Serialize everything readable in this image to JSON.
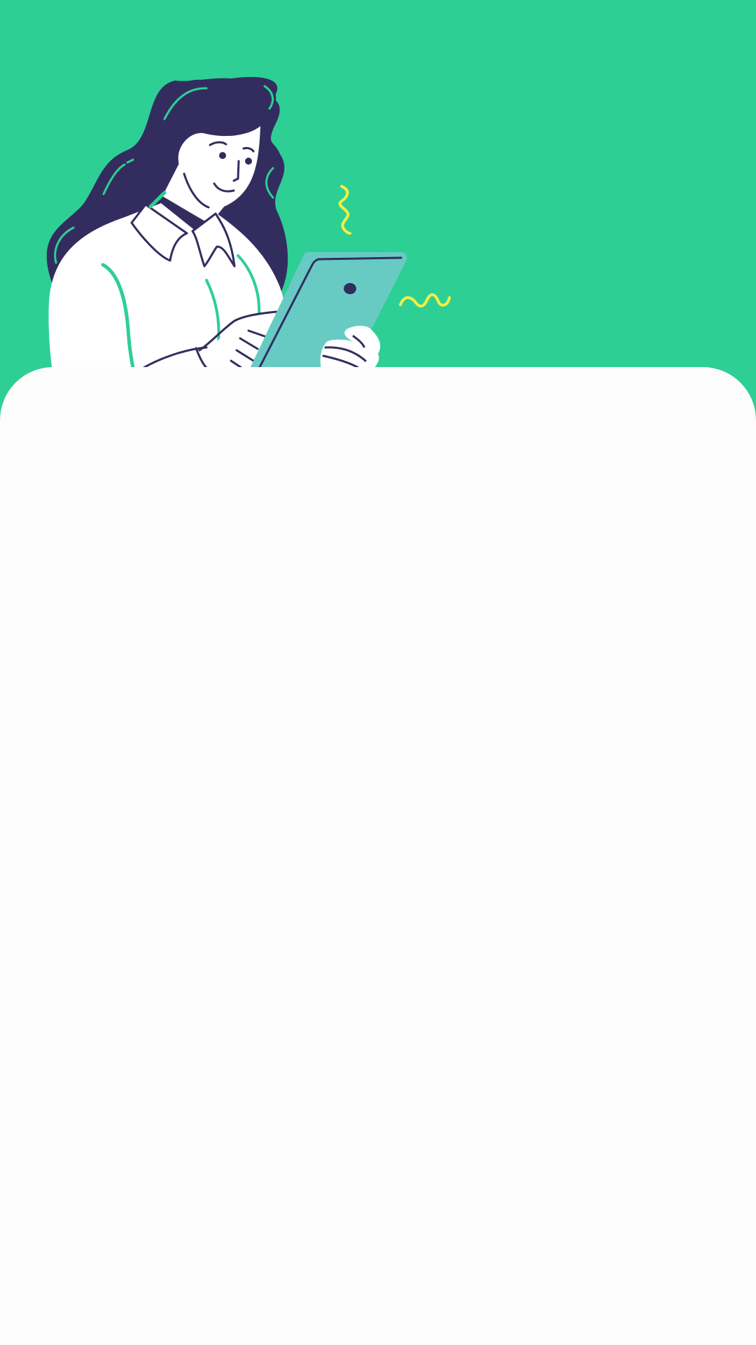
{
  "screen": {
    "name": "onboarding-illustration-screen",
    "hero": {
      "illustration": "woman-using-tablet",
      "background_color": "#2ecf94",
      "colors": {
        "hair": "#332d5f",
        "shirt": "#ffffff",
        "tablet": "#67cbc4",
        "accent_lines": "#2ecf94",
        "sparkles": "#f2f043"
      }
    },
    "sheet": {
      "background_color": "#fcfcfc"
    }
  }
}
